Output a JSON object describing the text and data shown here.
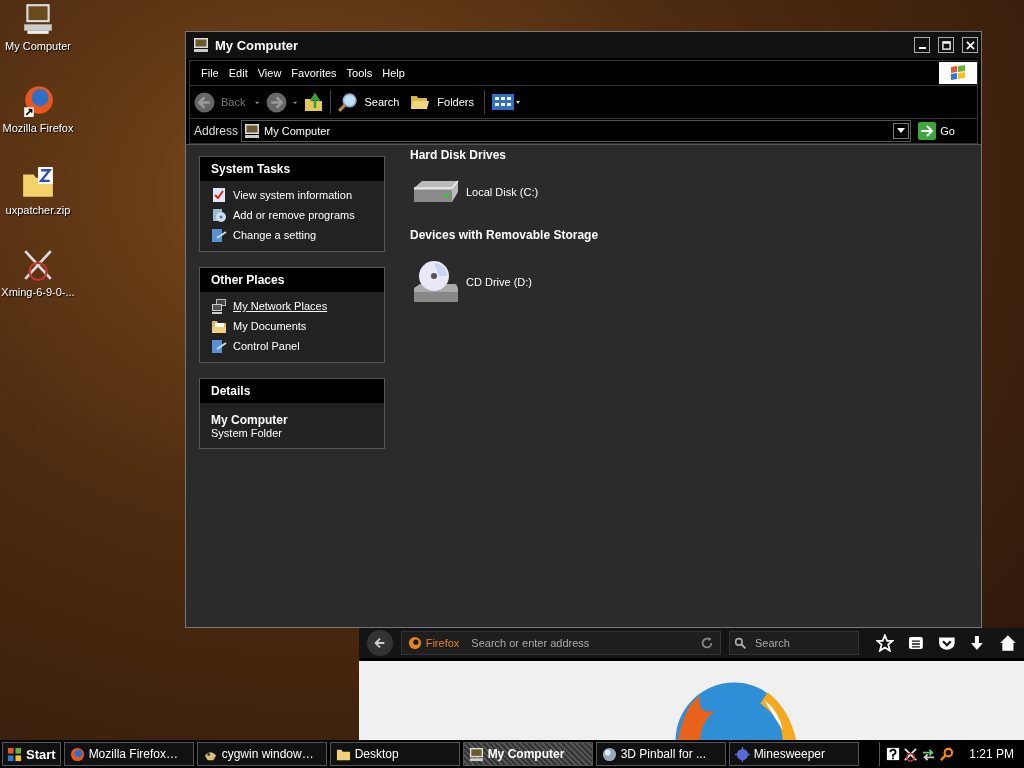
{
  "desktop_icons": [
    {
      "label": "My Computer",
      "kind": "computer"
    },
    {
      "label": "Mozilla Firefox",
      "kind": "firefox"
    },
    {
      "label": "uxpatcher.zip",
      "kind": "zip"
    },
    {
      "label": "Xming-6-9-0-...",
      "kind": "xming"
    }
  ],
  "window": {
    "title": "My Computer",
    "menu": [
      "File",
      "Edit",
      "View",
      "Favorites",
      "Tools",
      "Help"
    ],
    "toolbar": {
      "back": "Back",
      "search": "Search",
      "folders": "Folders"
    },
    "address": {
      "label": "Address",
      "value": "My Computer",
      "go": "Go"
    },
    "task_panels": [
      {
        "title": "System Tasks",
        "items": [
          {
            "label": "View system information",
            "kind": "sysinfo",
            "hovered": false
          },
          {
            "label": "Add or remove programs",
            "kind": "programs",
            "hovered": false
          },
          {
            "label": "Change a setting",
            "kind": "setting",
            "hovered": false
          }
        ]
      },
      {
        "title": "Other Places",
        "items": [
          {
            "label": "My Network Places",
            "kind": "network",
            "hovered": true
          },
          {
            "label": "My Documents",
            "kind": "documents",
            "hovered": false
          },
          {
            "label": "Control Panel",
            "kind": "setting",
            "hovered": false
          }
        ]
      }
    ],
    "details": {
      "title": "Details",
      "name": "My Computer",
      "type": "System Folder"
    },
    "groups": [
      {
        "title": "Hard Disk Drives",
        "items": [
          {
            "label": "Local Disk (C:)",
            "kind": "disk"
          }
        ]
      },
      {
        "title": "Devices with Removable Storage",
        "items": [
          {
            "label": "CD Drive (D:)",
            "kind": "cd"
          }
        ]
      }
    ]
  },
  "browser": {
    "brand": "Firefox",
    "address_placeholder": "Search or enter address",
    "search_placeholder": "Search"
  },
  "taskbar": {
    "start": "Start",
    "buttons": [
      {
        "label": "Mozilla Firefox…",
        "kind": "firefox",
        "selected": false
      },
      {
        "label": "cygwin window…",
        "kind": "cygwin",
        "selected": false
      },
      {
        "label": "Desktop",
        "kind": "folder",
        "selected": false
      },
      {
        "label": "My Computer",
        "kind": "computer",
        "selected": true
      },
      {
        "label": "3D Pinball for ...",
        "kind": "pinball",
        "selected": false
      },
      {
        "label": "Minesweeper",
        "kind": "mine",
        "selected": false
      }
    ],
    "clock": "1:21 PM"
  }
}
